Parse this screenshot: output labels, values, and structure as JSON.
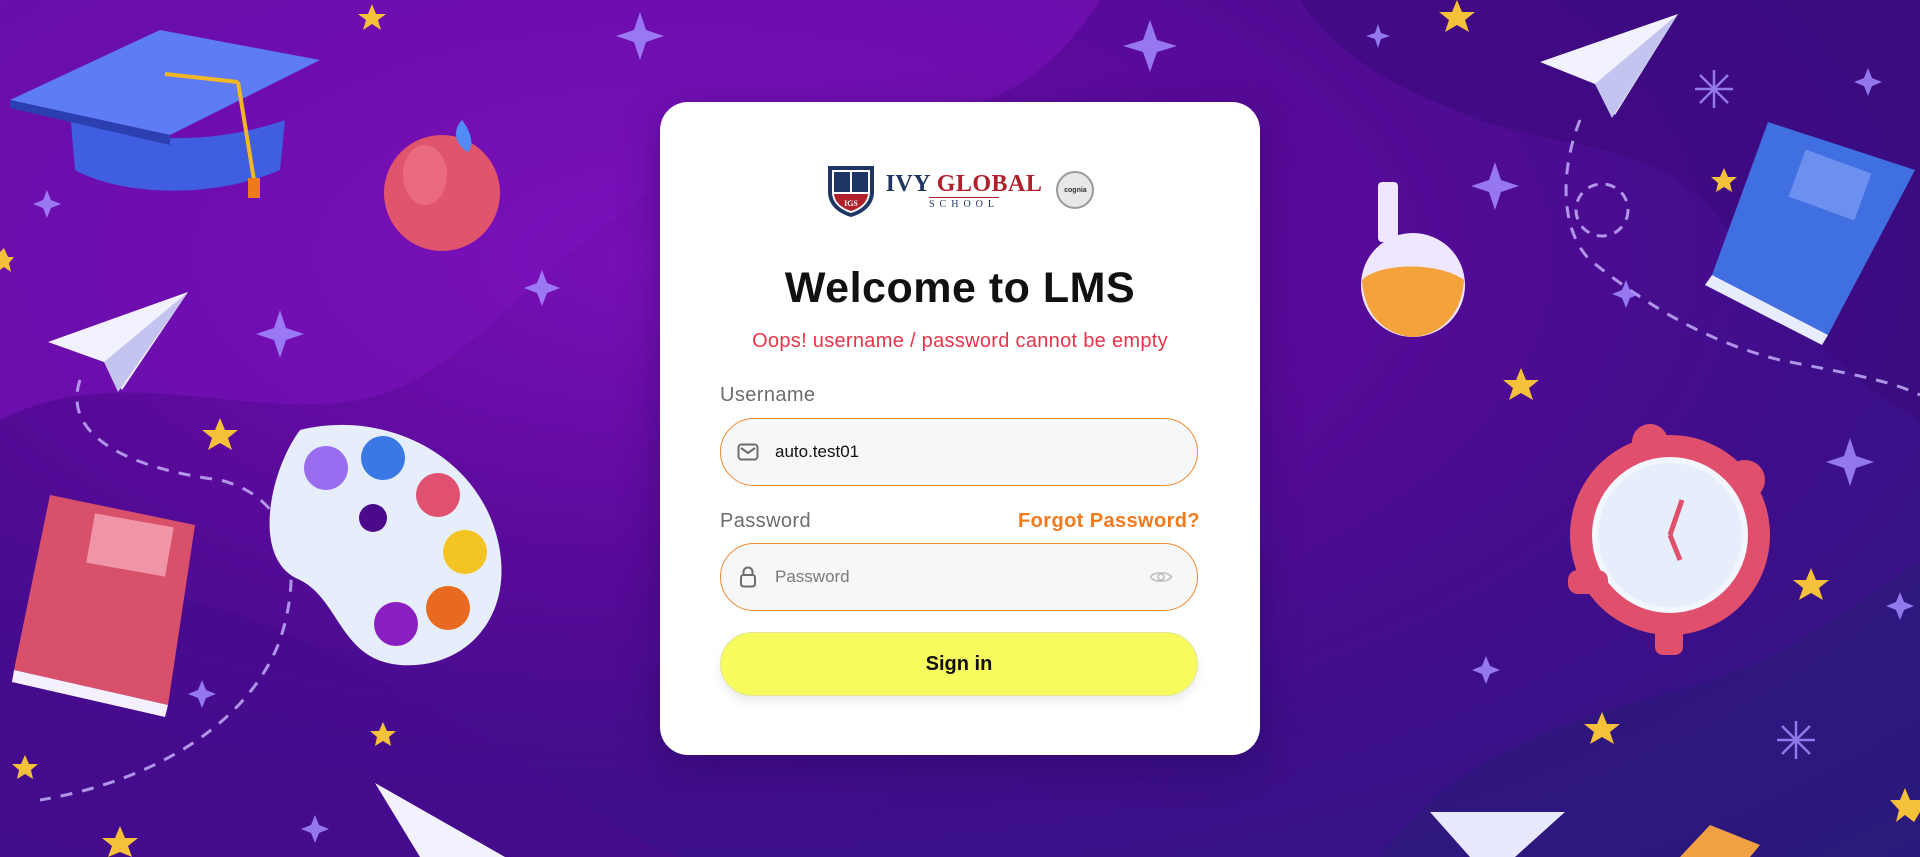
{
  "logo": {
    "name_part1": "IVY ",
    "name_part2": "GLOBAL",
    "sub": "SCHOOL",
    "crest_text": "IGS",
    "badge_text": "cognia"
  },
  "login": {
    "title": "Welcome to LMS",
    "error": "Oops! username / password cannot be empty",
    "username_label": "Username",
    "username_value": "auto.test01",
    "password_label": "Password",
    "password_placeholder": "Password",
    "password_value": "",
    "forgot_label": "Forgot Password?",
    "signin_label": "Sign in"
  },
  "icons": {
    "username": "envelope-icon",
    "password": "lock-icon",
    "toggle": "eye-icon"
  },
  "colors": {
    "accent": "#f07a1d",
    "error": "#e8334a",
    "button": "#f7fb5e",
    "background": "#5a0a9a"
  }
}
